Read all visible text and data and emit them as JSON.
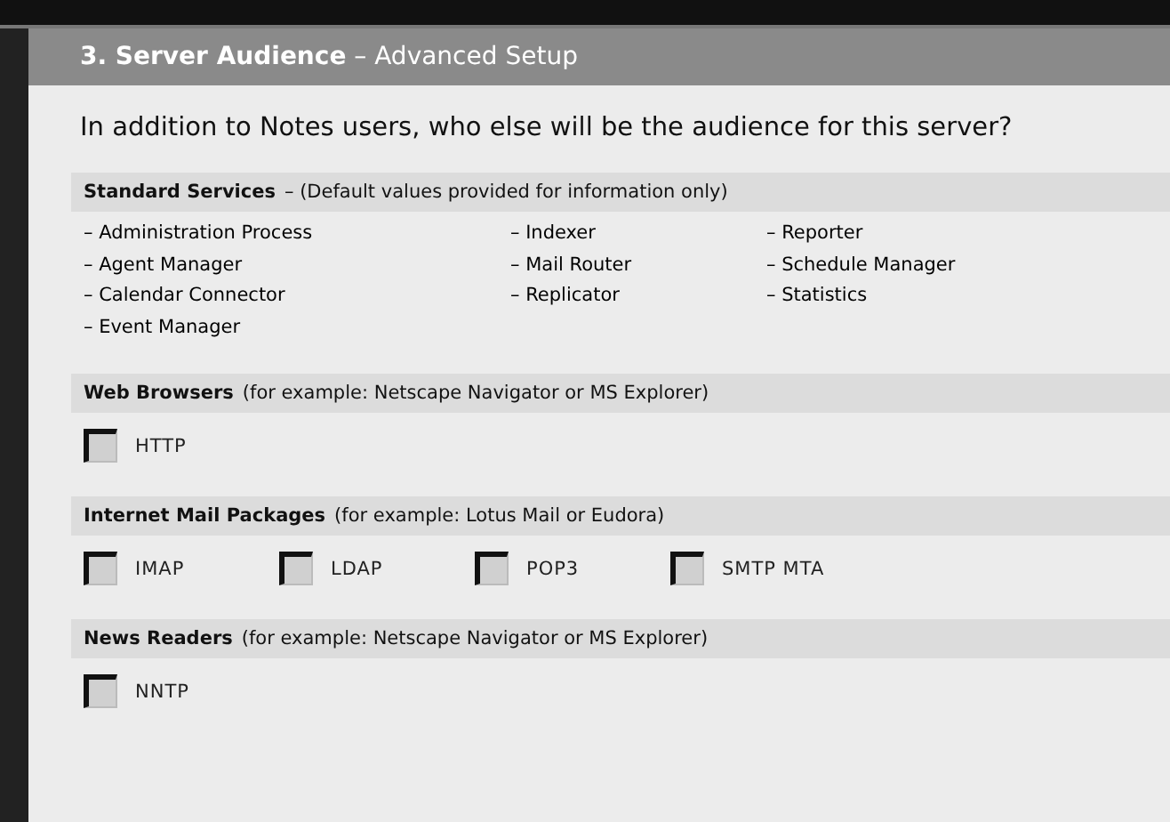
{
  "header": {
    "title": "**3. Server Audience** – Advanced Setup"
  },
  "question": "In addition to Notes users, who else will be the audience for this server?",
  "standard_services": {
    "title": "Standard Services",
    "note": "– (Default values provided for information only)",
    "columns": [
      [
        "– Administration Process",
        "– Agent Manager",
        "– Calendar Connector",
        "– Event Manager"
      ],
      [
        "– Indexer",
        "– Mail Router",
        "– Replicator"
      ],
      [
        "– Reporter",
        "– Schedule Manager",
        "– Statistics"
      ]
    ]
  },
  "sections": [
    {
      "title": "Web Browsers",
      "note": "(for example: Netscape Navigator or MS Explorer)",
      "options": [
        {
          "label": "HTTP",
          "checked": false
        }
      ]
    },
    {
      "title": "Internet Mail Packages",
      "note": "(for example: Lotus Mail or Eudora)",
      "options": [
        {
          "label": "IMAP",
          "checked": false
        },
        {
          "label": "LDAP",
          "checked": false
        },
        {
          "label": "POP3",
          "checked": false
        },
        {
          "label": "SMTP MTA",
          "checked": false
        }
      ]
    },
    {
      "title": "News Readers",
      "note": "(for example: Netscape Navigator or MS Explorer)",
      "options": [
        {
          "label": "NNTP",
          "checked": false
        }
      ]
    }
  ]
}
